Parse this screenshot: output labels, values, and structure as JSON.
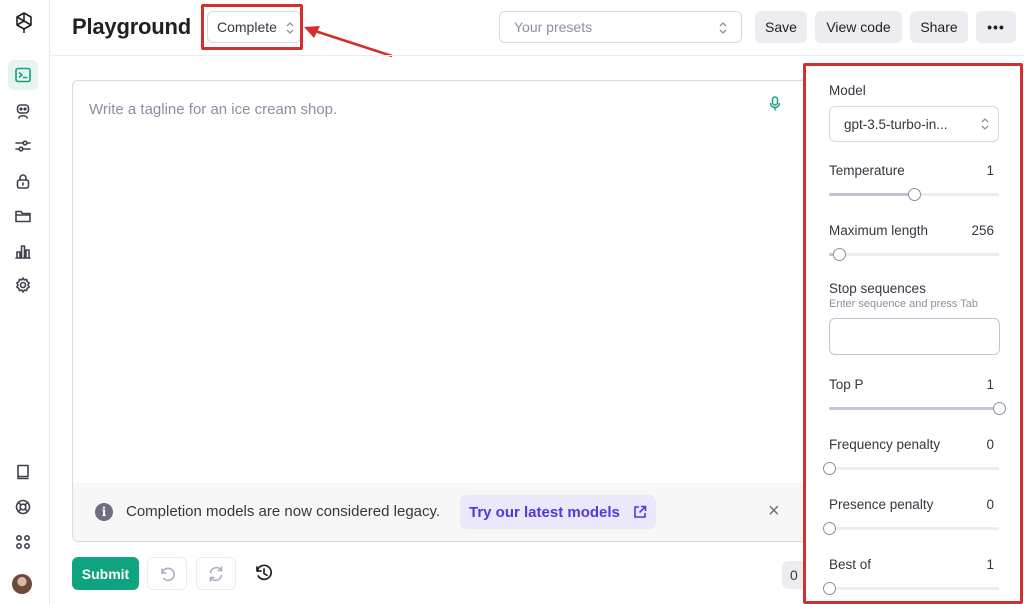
{
  "sidebar": {
    "logo": "openai-logo",
    "items": [
      {
        "name": "playground",
        "icon": "terminal-icon",
        "active": true
      },
      {
        "name": "assistants",
        "icon": "robot-icon"
      },
      {
        "name": "fine-tuning",
        "icon": "sliders-icon"
      },
      {
        "name": "api-keys",
        "icon": "lock-icon"
      },
      {
        "name": "files",
        "icon": "folder-icon"
      },
      {
        "name": "usage",
        "icon": "bar-chart-icon"
      },
      {
        "name": "settings",
        "icon": "gear-icon"
      }
    ],
    "bottom": [
      {
        "name": "docs",
        "icon": "book-icon"
      },
      {
        "name": "help",
        "icon": "lifebuoy-icon"
      },
      {
        "name": "apps",
        "icon": "grid-icon"
      }
    ]
  },
  "header": {
    "title": "Playground",
    "mode": "Complete",
    "presets_placeholder": "Your presets",
    "save": "Save",
    "view_code": "View code",
    "share": "Share",
    "more": "•••"
  },
  "editor": {
    "placeholder": "Write a tagline for an ice cream shop."
  },
  "banner": {
    "text": "Completion models are now considered legacy.",
    "link": "Try our latest models",
    "close": "×"
  },
  "actions": {
    "submit": "Submit",
    "token_count": "0"
  },
  "settings": {
    "model_label": "Model",
    "model_value": "gpt-3.5-turbo-in...",
    "temperature": {
      "label": "Temperature",
      "value": "1",
      "fraction": 0.5
    },
    "max_length": {
      "label": "Maximum length",
      "value": "256",
      "fraction": 0.06
    },
    "stop_sequences": {
      "label": "Stop sequences",
      "hint": "Enter sequence and press Tab"
    },
    "top_p": {
      "label": "Top P",
      "value": "1",
      "fraction": 1.0
    },
    "frequency_penalty": {
      "label": "Frequency penalty",
      "value": "0",
      "fraction": 0.0
    },
    "presence_penalty": {
      "label": "Presence penalty",
      "value": "0",
      "fraction": 0.0
    },
    "best_of": {
      "label": "Best of",
      "value": "1",
      "fraction": 0.0
    }
  },
  "colors": {
    "accent": "#10a37f",
    "annotation": "#d32f2f",
    "link": "#5436da"
  }
}
